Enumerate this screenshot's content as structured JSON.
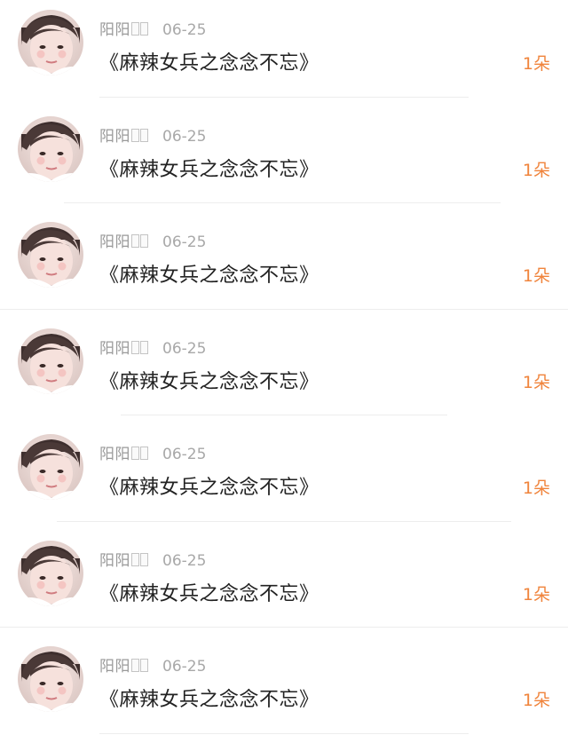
{
  "colors": {
    "accent": "#f0843c",
    "meta_gray": "#9a9a9a",
    "title": "#222222"
  },
  "items": [
    {
      "username": "阳阳",
      "date": "06-25",
      "title": "《麻辣女兵之念念不忘》",
      "count": "1朵"
    },
    {
      "username": "阳阳",
      "date": "06-25",
      "title": "《麻辣女兵之念念不忘》",
      "count": "1朵"
    },
    {
      "username": "阳阳",
      "date": "06-25",
      "title": "《麻辣女兵之念念不忘》",
      "count": "1朵"
    },
    {
      "username": "阳阳",
      "date": "06-25",
      "title": "《麻辣女兵之念念不忘》",
      "count": "1朵"
    },
    {
      "username": "阳阳",
      "date": "06-25",
      "title": "《麻辣女兵之念念不忘》",
      "count": "1朵"
    },
    {
      "username": "阳阳",
      "date": "06-25",
      "title": "《麻辣女兵之念念不忘》",
      "count": "1朵"
    },
    {
      "username": "阳阳",
      "date": "06-25",
      "title": "《麻辣女兵之念念不忘》",
      "count": "1朵"
    }
  ]
}
